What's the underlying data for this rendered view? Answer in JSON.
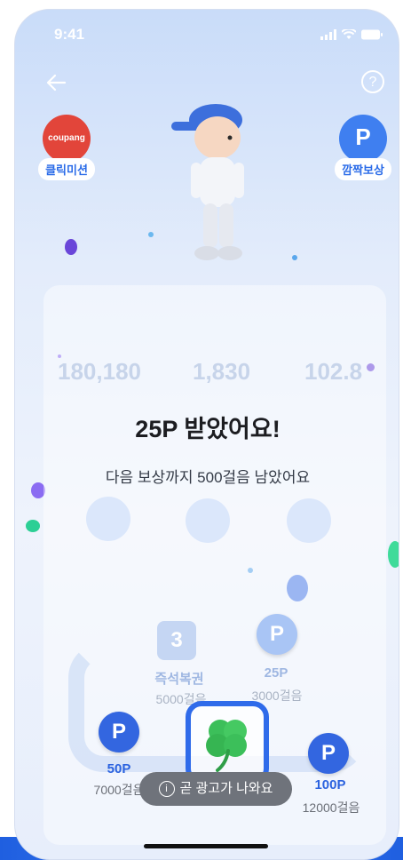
{
  "status_bar": {
    "time": "9:41"
  },
  "left_badge": {
    "logo_text": "coupang",
    "label": "클릭미션"
  },
  "right_badge": {
    "icon_text": "P",
    "label": "깜짝보상"
  },
  "headline": "25P 받았어요!",
  "subline": "다음 보상까지 500걸음 남았어요",
  "background_stats": {
    "values": [
      "180,180",
      "1,830",
      "102.8"
    ]
  },
  "road_rewards": [
    {
      "icon_text": "3",
      "name": "즉석복권",
      "steps": "5000걸음"
    },
    {
      "icon_text": "P",
      "name": "25P",
      "steps": "3000걸음"
    },
    {
      "icon_text": "P",
      "name": "50P",
      "steps": "7000걸음"
    },
    {
      "icon_text": "P",
      "name": "100P",
      "steps": "12000걸음"
    }
  ],
  "toast": {
    "text": "곧 광고가 나와요"
  },
  "colors": {
    "accent": "#2f6bea",
    "coupang_red": "#e2453a"
  }
}
